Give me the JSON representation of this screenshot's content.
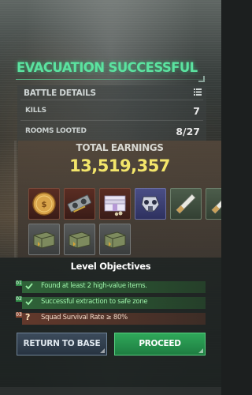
{
  "title": "EVACUATION SUCCESSFUL",
  "battle_details": {
    "header": "BATTLE DETAILS",
    "rows": [
      {
        "label": "KILLS",
        "value": "7"
      },
      {
        "label": "ROOMS LOOTED",
        "value": "8/27"
      }
    ]
  },
  "earnings": {
    "label": "TOTAL EARNINGS",
    "value": "13,519,357"
  },
  "loot": [
    {
      "icon": "gold-coin-icon",
      "rarity": "gold"
    },
    {
      "icon": "graphics-card-icon",
      "rarity": "gold"
    },
    {
      "icon": "cash-stack-icon",
      "rarity": "gold"
    },
    {
      "icon": "gas-mask-icon",
      "rarity": "blue"
    },
    {
      "icon": "cigarette-icon",
      "rarity": "green"
    },
    {
      "icon": "cigarette-icon",
      "rarity": "green"
    },
    {
      "icon": "ammo-box-icon",
      "rarity": "gray"
    },
    {
      "icon": "ammo-box-icon",
      "rarity": "gray"
    },
    {
      "icon": "ammo-box-icon",
      "rarity": "gray"
    }
  ],
  "objectives": {
    "title": "Level Objectives",
    "items": [
      {
        "num": "01",
        "text": "Found at least 2 high-value items.",
        "status": "done"
      },
      {
        "num": "02",
        "text": "Successful extraction to safe zone",
        "status": "done"
      },
      {
        "num": "03",
        "text": "Squad Survival Rate ≥ 80%",
        "status": "pending"
      }
    ]
  },
  "buttons": {
    "return_label": "RETURN TO BASE",
    "proceed_label": "PROCEED"
  },
  "colors": {
    "success_green": "#5be3a0",
    "earnings_yellow": "#f3e56a",
    "proceed_green": "#2fa85a",
    "return_slate": "#3c4b5c"
  }
}
